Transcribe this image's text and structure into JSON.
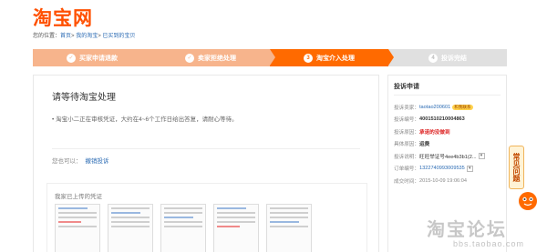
{
  "brand": {
    "logo": "淘宝网",
    "accent": "#ff5000"
  },
  "breadcrumb": {
    "prefix": "您的位置：",
    "items": [
      "首页",
      "我的淘宝",
      "已买到的宝贝"
    ]
  },
  "steps": [
    {
      "num": "1",
      "label": "买家申请退款",
      "state": "done"
    },
    {
      "num": "2",
      "label": "卖家拒绝处理",
      "state": "done"
    },
    {
      "num": "3",
      "label": "淘宝介入处理",
      "state": "current"
    },
    {
      "num": "4",
      "label": "投诉完结",
      "state": "todo"
    }
  ],
  "main": {
    "title": "请等待淘宝处理",
    "desc": "• 淘宝小二正在审核凭证，大约在4~6个工作日给出答复，请耐心等待。",
    "cancel_prefix": "您也可以：",
    "cancel_link": "撤销投诉",
    "evidence_title": "我家已上传的凭证"
  },
  "side": {
    "title": "投诉申请",
    "rows": [
      {
        "key": "投诉卖家：",
        "value": "taotao200601",
        "style": "link",
        "badge": "和我联系"
      },
      {
        "key": "投诉编号：",
        "value": "4001510210004863",
        "style": "bold"
      },
      {
        "key": "投诉原因：",
        "value": "承诺的没做到",
        "style": "red"
      },
      {
        "key": "具体原因：",
        "value": "运费",
        "style": "bold"
      },
      {
        "key": "投诉说明：",
        "value": "旺旺举证号4ee4b3b1(2...",
        "style": "plain",
        "select": "▾"
      },
      {
        "key": "订单编号：",
        "value": "1322740993009535",
        "style": "link",
        "select": "▾"
      },
      {
        "key": "成交时间：",
        "value": "2015-10-09 19:06:04",
        "style": "muted"
      }
    ]
  },
  "faq": "常见问题",
  "watermark": {
    "main": "淘宝论坛",
    "sub": "bbs.taobao.com"
  }
}
